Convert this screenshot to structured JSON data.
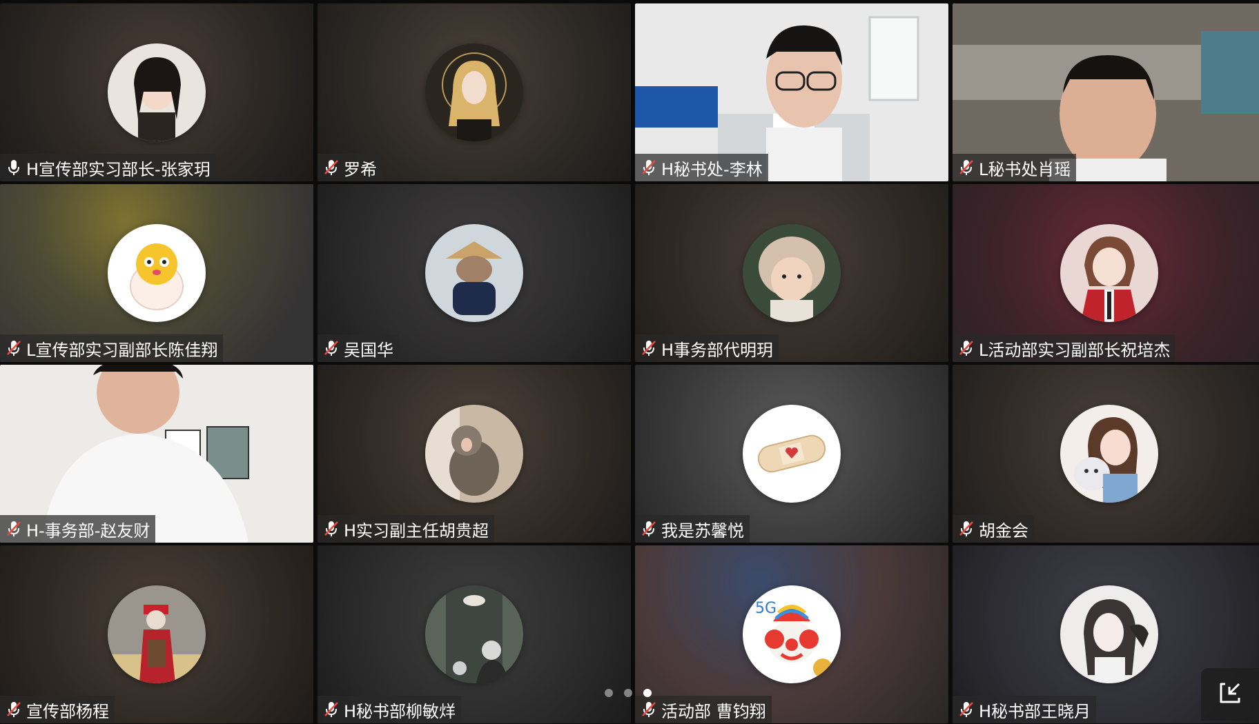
{
  "participants": [
    {
      "name": "H宣传部实习部长-张家玥",
      "mic": "on"
    },
    {
      "name": "罗希",
      "mic": "muted"
    },
    {
      "name": "H秘书处-李林",
      "mic": "muted"
    },
    {
      "name": "L秘书处肖瑶",
      "mic": "muted"
    },
    {
      "name": "L宣传部实习副部长陈佳翔",
      "mic": "muted"
    },
    {
      "name": "吴国华",
      "mic": "muted"
    },
    {
      "name": "H事务部代明玥",
      "mic": "muted"
    },
    {
      "name": "L活动部实习副部长祝培杰",
      "mic": "muted"
    },
    {
      "name": "H-事务部-赵友财",
      "mic": "muted"
    },
    {
      "name": "H实习副主任胡贵超",
      "mic": "muted"
    },
    {
      "name": "我是苏馨悦",
      "mic": "muted"
    },
    {
      "name": "胡金会",
      "mic": "muted"
    },
    {
      "name": "宣传部杨程",
      "mic": "muted"
    },
    {
      "name": "H秘书部柳敏烊",
      "mic": "muted"
    },
    {
      "name": "活动部 曹钧翔",
      "mic": "muted"
    },
    {
      "name": "H秘书部王晓月",
      "mic": "muted"
    }
  ],
  "pager": {
    "total": 3,
    "current": 3
  },
  "colors": {
    "muted_icon": "#e8483f",
    "label_text": "#ffffff"
  },
  "icons": {
    "mic_on": "microphone-icon",
    "mic_muted": "microphone-muted-icon",
    "exit": "exit-fullscreen-icon"
  }
}
